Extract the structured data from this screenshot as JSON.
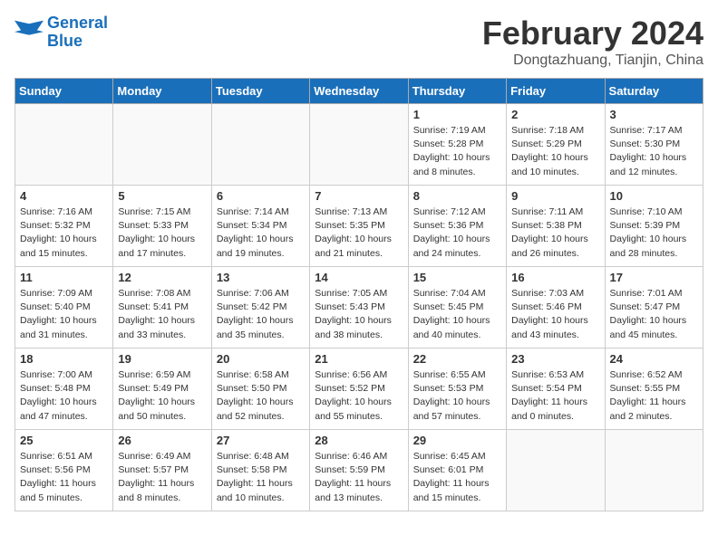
{
  "header": {
    "logo_line1": "General",
    "logo_line2": "Blue",
    "month_title": "February 2024",
    "location": "Dongtazhuang, Tianjin, China"
  },
  "weekdays": [
    "Sunday",
    "Monday",
    "Tuesday",
    "Wednesday",
    "Thursday",
    "Friday",
    "Saturday"
  ],
  "weeks": [
    [
      {
        "day": "",
        "info": ""
      },
      {
        "day": "",
        "info": ""
      },
      {
        "day": "",
        "info": ""
      },
      {
        "day": "",
        "info": ""
      },
      {
        "day": "1",
        "info": "Sunrise: 7:19 AM\nSunset: 5:28 PM\nDaylight: 10 hours\nand 8 minutes."
      },
      {
        "day": "2",
        "info": "Sunrise: 7:18 AM\nSunset: 5:29 PM\nDaylight: 10 hours\nand 10 minutes."
      },
      {
        "day": "3",
        "info": "Sunrise: 7:17 AM\nSunset: 5:30 PM\nDaylight: 10 hours\nand 12 minutes."
      }
    ],
    [
      {
        "day": "4",
        "info": "Sunrise: 7:16 AM\nSunset: 5:32 PM\nDaylight: 10 hours\nand 15 minutes."
      },
      {
        "day": "5",
        "info": "Sunrise: 7:15 AM\nSunset: 5:33 PM\nDaylight: 10 hours\nand 17 minutes."
      },
      {
        "day": "6",
        "info": "Sunrise: 7:14 AM\nSunset: 5:34 PM\nDaylight: 10 hours\nand 19 minutes."
      },
      {
        "day": "7",
        "info": "Sunrise: 7:13 AM\nSunset: 5:35 PM\nDaylight: 10 hours\nand 21 minutes."
      },
      {
        "day": "8",
        "info": "Sunrise: 7:12 AM\nSunset: 5:36 PM\nDaylight: 10 hours\nand 24 minutes."
      },
      {
        "day": "9",
        "info": "Sunrise: 7:11 AM\nSunset: 5:38 PM\nDaylight: 10 hours\nand 26 minutes."
      },
      {
        "day": "10",
        "info": "Sunrise: 7:10 AM\nSunset: 5:39 PM\nDaylight: 10 hours\nand 28 minutes."
      }
    ],
    [
      {
        "day": "11",
        "info": "Sunrise: 7:09 AM\nSunset: 5:40 PM\nDaylight: 10 hours\nand 31 minutes."
      },
      {
        "day": "12",
        "info": "Sunrise: 7:08 AM\nSunset: 5:41 PM\nDaylight: 10 hours\nand 33 minutes."
      },
      {
        "day": "13",
        "info": "Sunrise: 7:06 AM\nSunset: 5:42 PM\nDaylight: 10 hours\nand 35 minutes."
      },
      {
        "day": "14",
        "info": "Sunrise: 7:05 AM\nSunset: 5:43 PM\nDaylight: 10 hours\nand 38 minutes."
      },
      {
        "day": "15",
        "info": "Sunrise: 7:04 AM\nSunset: 5:45 PM\nDaylight: 10 hours\nand 40 minutes."
      },
      {
        "day": "16",
        "info": "Sunrise: 7:03 AM\nSunset: 5:46 PM\nDaylight: 10 hours\nand 43 minutes."
      },
      {
        "day": "17",
        "info": "Sunrise: 7:01 AM\nSunset: 5:47 PM\nDaylight: 10 hours\nand 45 minutes."
      }
    ],
    [
      {
        "day": "18",
        "info": "Sunrise: 7:00 AM\nSunset: 5:48 PM\nDaylight: 10 hours\nand 47 minutes."
      },
      {
        "day": "19",
        "info": "Sunrise: 6:59 AM\nSunset: 5:49 PM\nDaylight: 10 hours\nand 50 minutes."
      },
      {
        "day": "20",
        "info": "Sunrise: 6:58 AM\nSunset: 5:50 PM\nDaylight: 10 hours\nand 52 minutes."
      },
      {
        "day": "21",
        "info": "Sunrise: 6:56 AM\nSunset: 5:52 PM\nDaylight: 10 hours\nand 55 minutes."
      },
      {
        "day": "22",
        "info": "Sunrise: 6:55 AM\nSunset: 5:53 PM\nDaylight: 10 hours\nand 57 minutes."
      },
      {
        "day": "23",
        "info": "Sunrise: 6:53 AM\nSunset: 5:54 PM\nDaylight: 11 hours\nand 0 minutes."
      },
      {
        "day": "24",
        "info": "Sunrise: 6:52 AM\nSunset: 5:55 PM\nDaylight: 11 hours\nand 2 minutes."
      }
    ],
    [
      {
        "day": "25",
        "info": "Sunrise: 6:51 AM\nSunset: 5:56 PM\nDaylight: 11 hours\nand 5 minutes."
      },
      {
        "day": "26",
        "info": "Sunrise: 6:49 AM\nSunset: 5:57 PM\nDaylight: 11 hours\nand 8 minutes."
      },
      {
        "day": "27",
        "info": "Sunrise: 6:48 AM\nSunset: 5:58 PM\nDaylight: 11 hours\nand 10 minutes."
      },
      {
        "day": "28",
        "info": "Sunrise: 6:46 AM\nSunset: 5:59 PM\nDaylight: 11 hours\nand 13 minutes."
      },
      {
        "day": "29",
        "info": "Sunrise: 6:45 AM\nSunset: 6:01 PM\nDaylight: 11 hours\nand 15 minutes."
      },
      {
        "day": "",
        "info": ""
      },
      {
        "day": "",
        "info": ""
      }
    ]
  ]
}
